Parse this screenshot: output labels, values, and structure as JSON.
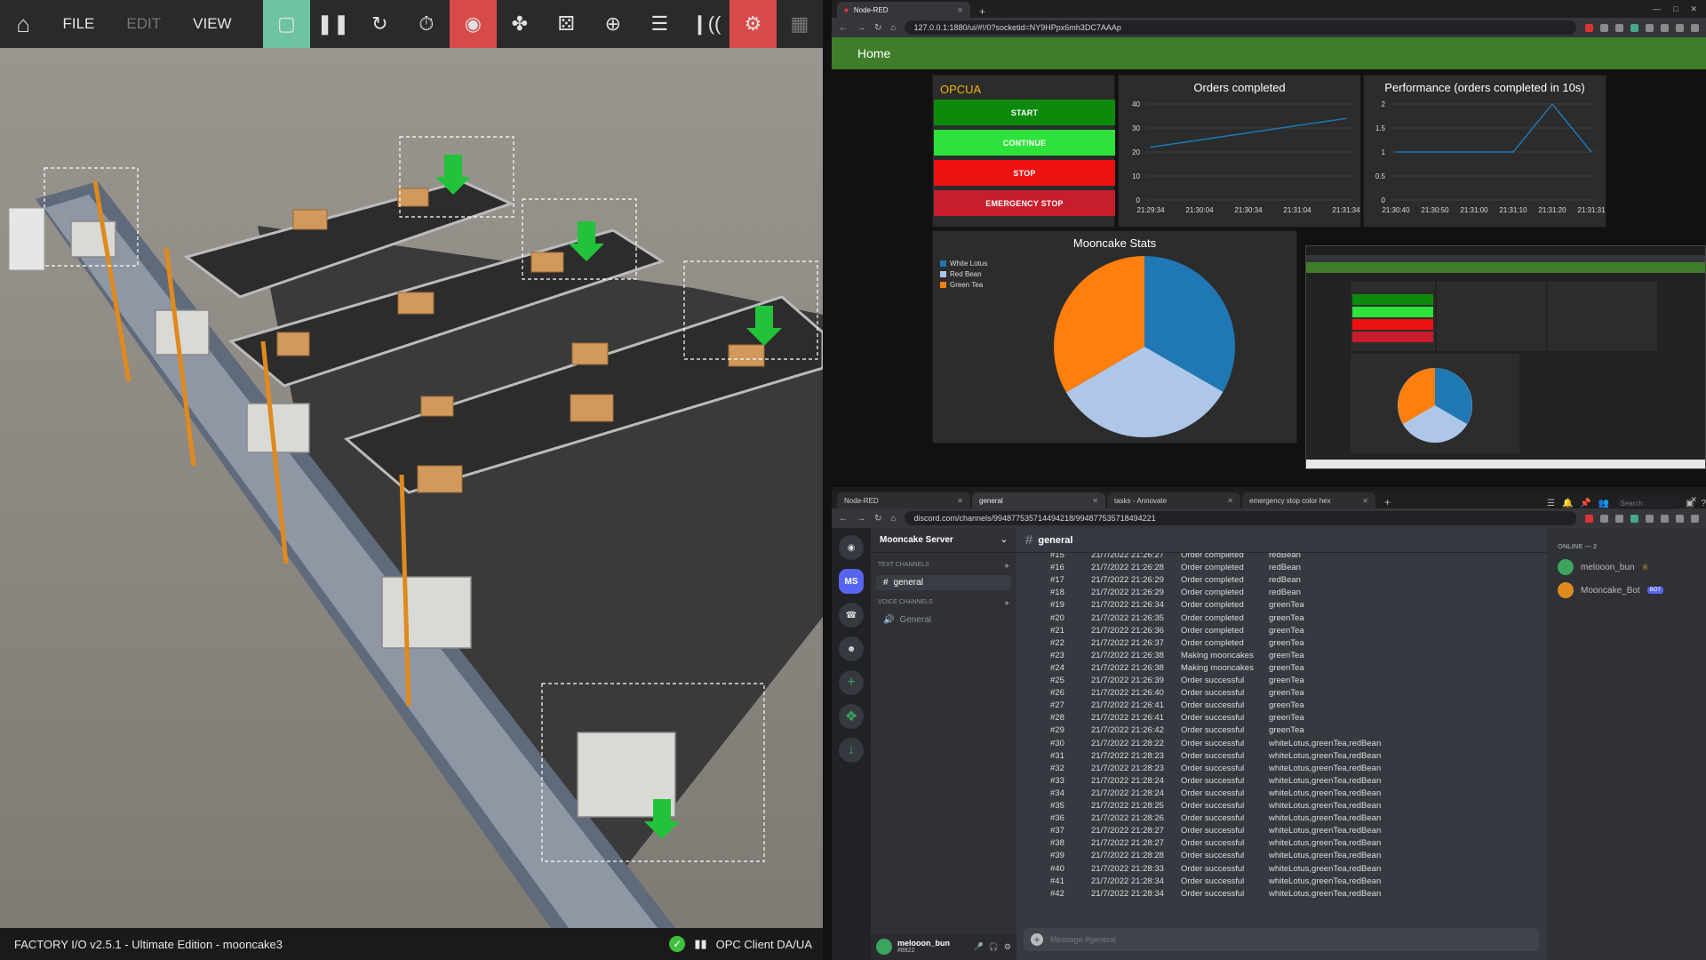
{
  "factoryio": {
    "menu": [
      "FILE",
      "EDIT",
      "VIEW"
    ],
    "status_title": "FACTORY I/O v2.5.1 - Ultimate Edition - mooncake3",
    "driver": "OPC Client DA/UA"
  },
  "nodered_browser": {
    "tab_title": "Node-RED",
    "url": "127.0.0.1:1880/ui/#!/0?socketid=NY9HPpx6mh3DC7AAAp",
    "header": "Home",
    "opcua_title": "OPCUA",
    "buttons": [
      {
        "label": "START",
        "color": "#0b8a0b"
      },
      {
        "label": "CONTINUE",
        "color": "#2de23a"
      },
      {
        "label": "STOP",
        "color": "#ee1111"
      },
      {
        "label": "EMERGENCY STOP",
        "color": "#c81d2c"
      }
    ],
    "orders_chart_title": "Orders completed",
    "perf_chart_title": "Performance (orders completed in 10s)",
    "stats_title": "Mooncake Stats"
  },
  "chart_data": [
    {
      "type": "line",
      "title": "Orders completed",
      "x": [
        "21:29:34",
        "21:30:04",
        "21:30:34",
        "21:31:04",
        "21:31:34"
      ],
      "y": [
        22,
        25,
        28,
        31,
        34
      ],
      "yticks": [
        0,
        10,
        20,
        30,
        40
      ],
      "ylim": [
        0,
        40
      ]
    },
    {
      "type": "line",
      "title": "Performance (orders completed in 10s)",
      "x": [
        "21:30:40",
        "21:30:50",
        "21:31:00",
        "21:31:10",
        "21:31:20",
        "21:31:31"
      ],
      "y": [
        1,
        1,
        1,
        1,
        2,
        1
      ],
      "yticks": [
        0,
        0.5,
        1,
        1.5,
        2
      ],
      "ylim": [
        0,
        2
      ]
    },
    {
      "type": "pie",
      "title": "Mooncake Stats",
      "labels": [
        "White Lotus",
        "Red Bean",
        "Green Tea"
      ],
      "values": [
        33.3,
        33.3,
        33.4
      ],
      "colors": [
        "#1f77b4",
        "#aec7e8",
        "#ff7f0e"
      ]
    }
  ],
  "discord_browser": {
    "tabs": [
      "Node-RED",
      "general",
      "tasks - Annovate",
      "emergency stop color hex"
    ],
    "url": "discord.com/channels/994877535714494218/994877535718494221",
    "server": "Mooncake Server",
    "text_channels_label": "TEXT CHANNELS",
    "voice_channels_label": "VOICE CHANNELS",
    "text_channel": "general",
    "voice_channel": "General",
    "channel_header": "general",
    "search_placeholder": "Search",
    "input_placeholder": "Message #general",
    "online_label": "ONLINE — 2",
    "members": [
      {
        "name": "melooon_bun",
        "badge": ""
      },
      {
        "name": "Mooncake_Bot",
        "badge": "BOT"
      }
    ],
    "user": {
      "name": "melooon_bun",
      "tag": "#8822"
    },
    "server_icon": "MS",
    "messages": [
      [
        "#15",
        "21/7/2022 21:26:27",
        "Order completed",
        "redBean"
      ],
      [
        "#16",
        "21/7/2022 21:26:28",
        "Order completed",
        "redBean"
      ],
      [
        "#17",
        "21/7/2022 21:26:29",
        "Order completed",
        "redBean"
      ],
      [
        "#18",
        "21/7/2022 21:26:29",
        "Order completed",
        "redBean"
      ],
      [
        "#19",
        "21/7/2022 21:26:34",
        "Order completed",
        "greenTea"
      ],
      [
        "#20",
        "21/7/2022 21:26:35",
        "Order completed",
        "greenTea"
      ],
      [
        "#21",
        "21/7/2022 21:26:36",
        "Order completed",
        "greenTea"
      ],
      [
        "#22",
        "21/7/2022 21:26:37",
        "Order completed",
        "greenTea"
      ],
      [
        "#23",
        "21/7/2022 21:26:38",
        "Making mooncakes",
        "greenTea"
      ],
      [
        "#24",
        "21/7/2022 21:26:38",
        "Making mooncakes",
        "greenTea"
      ],
      [
        "#25",
        "21/7/2022 21:26:39",
        "Order successful",
        "greenTea"
      ],
      [
        "#26",
        "21/7/2022 21:26:40",
        "Order successful",
        "greenTea"
      ],
      [
        "#27",
        "21/7/2022 21:26:41",
        "Order successful",
        "greenTea"
      ],
      [
        "#28",
        "21/7/2022 21:26:41",
        "Order successful",
        "greenTea"
      ],
      [
        "#29",
        "21/7/2022 21:26:42",
        "Order successful",
        "greenTea"
      ],
      [
        "#30",
        "21/7/2022 21:28:22",
        "Order successful",
        "whiteLotus,greenTea,redBean"
      ],
      [
        "#31",
        "21/7/2022 21:28:23",
        "Order successful",
        "whiteLotus,greenTea,redBean"
      ],
      [
        "#32",
        "21/7/2022 21:28:23",
        "Order successful",
        "whiteLotus,greenTea,redBean"
      ],
      [
        "#33",
        "21/7/2022 21:28:24",
        "Order successful",
        "whiteLotus,greenTea,redBean"
      ],
      [
        "#34",
        "21/7/2022 21:28:24",
        "Order successful",
        "whiteLotus,greenTea,redBean"
      ],
      [
        "#35",
        "21/7/2022 21:28:25",
        "Order successful",
        "whiteLotus,greenTea,redBean"
      ],
      [
        "#36",
        "21/7/2022 21:28:26",
        "Order successful",
        "whiteLotus,greenTea,redBean"
      ],
      [
        "#37",
        "21/7/2022 21:28:27",
        "Order successful",
        "whiteLotus,greenTea,redBean"
      ],
      [
        "#38",
        "21/7/2022 21:28:27",
        "Order successful",
        "whiteLotus,greenTea,redBean"
      ],
      [
        "#39",
        "21/7/2022 21:28:28",
        "Order successful",
        "whiteLotus,greenTea,redBean"
      ],
      [
        "#40",
        "21/7/2022 21:28:33",
        "Order successful",
        "whiteLotus,greenTea,redBean"
      ],
      [
        "#41",
        "21/7/2022 21:28:34",
        "Order successful",
        "whiteLotus,greenTea,redBean"
      ],
      [
        "#42",
        "21/7/2022 21:28:34",
        "Order successful",
        "whiteLotus,greenTea,redBean"
      ]
    ]
  }
}
